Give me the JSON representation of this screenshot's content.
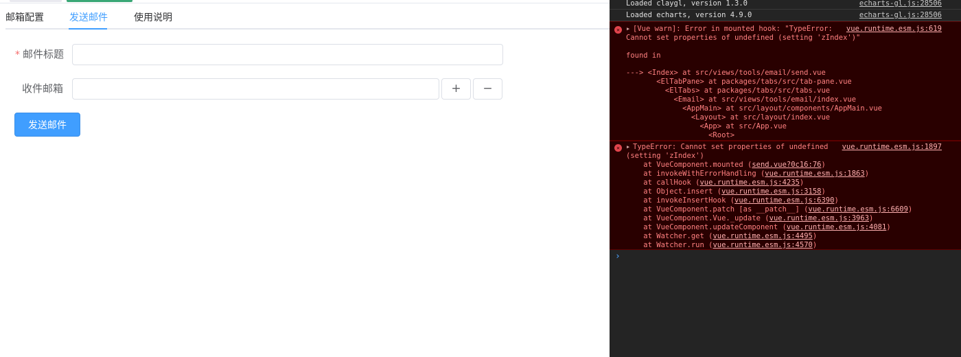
{
  "tabs": [
    {
      "label": "邮箱配置",
      "active": false
    },
    {
      "label": "发送邮件",
      "active": true
    },
    {
      "label": "使用说明",
      "active": false
    }
  ],
  "form": {
    "title_label": "邮件标题",
    "title_required_mark": "*",
    "title_value": "",
    "recipient_label": "收件邮箱",
    "recipient_value": "",
    "add_label": "+",
    "remove_label": "−",
    "send_label": "发送邮件"
  },
  "console": {
    "info": [
      {
        "text": "Loaded claygl, version 1.3.0",
        "source": "echarts-gl.js:28506"
      },
      {
        "text": "Loaded echarts, version 4.9.0",
        "source": "echarts-gl.js:28506"
      }
    ],
    "error1": {
      "source": "vue.runtime.esm.js:619",
      "lines": [
        "[Vue warn]: Error in mounted hook: \"TypeError:",
        "Cannot set properties of undefined (setting 'zIndex')\"",
        "",
        "found in",
        "",
        "---> <Index> at src/views/tools/email/send.vue",
        "       <ElTabPane> at packages/tabs/src/tab-pane.vue",
        "         <ElTabs> at packages/tabs/src/tabs.vue",
        "           <Email> at src/views/tools/email/index.vue",
        "             <AppMain> at src/layout/components/AppMain.vue",
        "               <Layout> at src/layout/index.vue",
        "                 <App> at src/App.vue",
        "                   <Root>"
      ]
    },
    "error2": {
      "source": "vue.runtime.esm.js:1897",
      "head1": "TypeError: Cannot set properties of undefined",
      "head2": "(setting 'zIndex')",
      "stack": [
        {
          "pre": "    at VueComponent.mounted (",
          "link": "send.vue?0c16:76",
          "post": ")"
        },
        {
          "pre": "    at invokeWithErrorHandling (",
          "link": "vue.runtime.esm.js:1863",
          "post": ")"
        },
        {
          "pre": "    at callHook (",
          "link": "vue.runtime.esm.js:4235",
          "post": ")"
        },
        {
          "pre": "    at Object.insert (",
          "link": "vue.runtime.esm.js:3158",
          "post": ")"
        },
        {
          "pre": "    at invokeInsertHook (",
          "link": "vue.runtime.esm.js:6390",
          "post": ")"
        },
        {
          "pre": "    at VueComponent.patch [as __patch__] (",
          "link": "vue.runtime.esm.js:6609",
          "post": ")"
        },
        {
          "pre": "    at VueComponent.Vue._update (",
          "link": "vue.runtime.esm.js:3963",
          "post": ")"
        },
        {
          "pre": "    at VueComponent.updateComponent (",
          "link": "vue.runtime.esm.js:4081",
          "post": ")"
        },
        {
          "pre": "    at Watcher.get (",
          "link": "vue.runtime.esm.js:4495",
          "post": ")"
        },
        {
          "pre": "    at Watcher.run (",
          "link": "vue.runtime.esm.js:4570",
          "post": ")"
        }
      ]
    },
    "prompt_symbol": "›"
  },
  "colors": {
    "accent": "#409eff",
    "error_text": "#ff8080",
    "error_bg": "#290000",
    "console_bg": "#242424"
  }
}
